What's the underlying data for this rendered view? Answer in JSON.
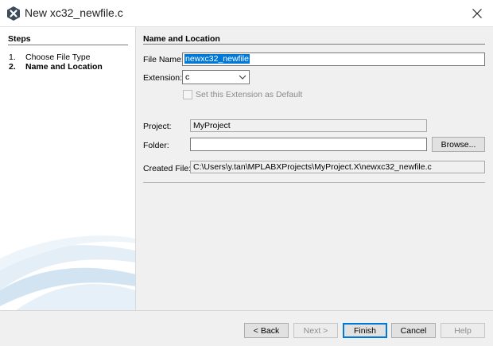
{
  "window": {
    "title": "New xc32_newfile.c"
  },
  "steps": {
    "heading": "Steps",
    "items": [
      {
        "num": "1.",
        "label": "Choose File Type"
      },
      {
        "num": "2.",
        "label": "Name and Location"
      }
    ]
  },
  "form": {
    "heading": "Name and Location",
    "file_name_label": "File Name:",
    "file_name_value": "newxc32_newfile",
    "extension_label": "Extension:",
    "extension_value": "c",
    "default_ext_label": "Set this Extension as Default",
    "project_label": "Project:",
    "project_value": "MyProject",
    "folder_label": "Folder:",
    "folder_value": "",
    "browse_label": "Browse...",
    "created_file_label": "Created File:",
    "created_file_value": "C:\\Users\\y.tan\\MPLABXProjects\\MyProject.X\\newxc32_newfile.c"
  },
  "buttons": {
    "back": "< Back",
    "next": "Next >",
    "finish": "Finish",
    "cancel": "Cancel",
    "help": "Help"
  },
  "colors": {
    "selection": "#0078d7",
    "accent": "#0078d7"
  }
}
